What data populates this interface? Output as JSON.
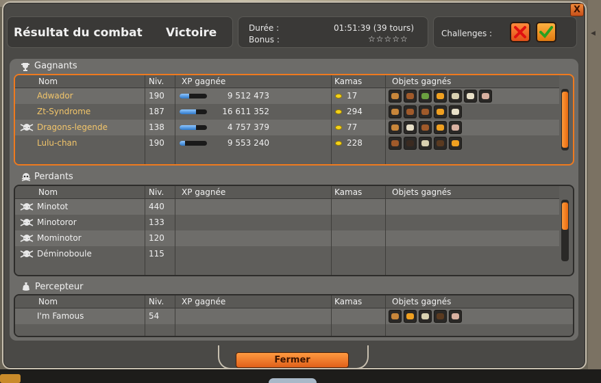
{
  "header": {
    "title": "Résultat du combat",
    "result": "Victoire",
    "duration_label": "Durée :",
    "duration_value": "01:51:39 (39 tours)",
    "bonus_label": "Bonus :",
    "bonus_stars": "☆☆☆☆☆",
    "challenges_label": "Challenges :",
    "close_label": "X"
  },
  "columns": [
    "Nom",
    "Niv.",
    "XP gagnée",
    "Kamas",
    "Objets gagnés"
  ],
  "winners": {
    "title": "Gagnants",
    "rows": [
      {
        "name": "Adwador",
        "level": "190",
        "xp": "9 512 473",
        "xp_fraction": 0.35,
        "kamas": "17",
        "items": [
          "#c8863a",
          "#a05a2a",
          "#6aa040",
          "#f0a020",
          "#d8d0b0",
          "#e8e0c8",
          "#d8b0a0"
        ],
        "skull": false
      },
      {
        "name": "Zt-Syndrome",
        "level": "187",
        "xp": "16 611 352",
        "xp_fraction": 0.6,
        "kamas": "294",
        "items": [
          "#c8863a",
          "#a05a2a",
          "#a05a2a",
          "#f0a020",
          "#e8e0c8"
        ],
        "skull": false
      },
      {
        "name": "Dragons-legende",
        "level": "138",
        "xp": "4 757 379",
        "xp_fraction": 0.6,
        "kamas": "77",
        "items": [
          "#c8863a",
          "#e8e0c8",
          "#a05a2a",
          "#f0a020",
          "#d8b0a0"
        ],
        "skull": true
      },
      {
        "name": "Lulu-chan",
        "level": "190",
        "xp": "9 553 240",
        "xp_fraction": 0.2,
        "kamas": "228",
        "items": [
          "#a05a2a",
          "#3a2a20",
          "#d8d0b0",
          "#5a3a20",
          "#f0a020"
        ],
        "skull": false
      }
    ]
  },
  "losers": {
    "title": "Perdants",
    "rows": [
      {
        "name": "Minotot",
        "level": "440"
      },
      {
        "name": "Minotoror",
        "level": "133"
      },
      {
        "name": "Mominotor",
        "level": "120"
      },
      {
        "name": "Déminoboule",
        "level": "115"
      }
    ]
  },
  "collector": {
    "title": "Percepteur",
    "rows": [
      {
        "name": "I'm Famous",
        "level": "54",
        "items": [
          "#c8863a",
          "#f0a020",
          "#d8d0b0",
          "#5a3a20",
          "#d8b0a0"
        ]
      }
    ]
  },
  "footer": {
    "close_button": "Fermer"
  },
  "colors": {
    "accent": "#f07a1e",
    "winner_name": "#f2c56a",
    "panel_bg": "#6d6c69",
    "window_bg": "#4a4946"
  }
}
